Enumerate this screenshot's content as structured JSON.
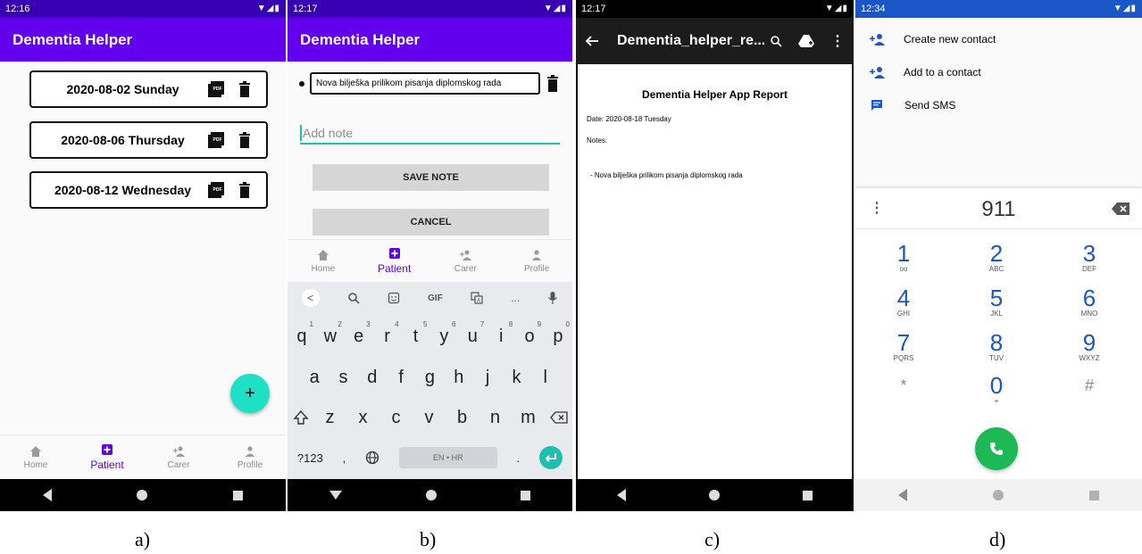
{
  "panel_a": {
    "status_time": "12:16",
    "app_title": "Dementia Helper",
    "notes": [
      {
        "date": "2020-08-02 Sunday"
      },
      {
        "date": "2020-08-06 Thursday"
      },
      {
        "date": "2020-08-12 Wednesday"
      }
    ],
    "fab_label": "+",
    "bottom_nav": [
      "Home",
      "Patient",
      "Carer",
      "Profile"
    ],
    "active_tab": "Patient"
  },
  "panel_b": {
    "status_time": "12:17",
    "app_title": "Dementia Helper",
    "note_item": "Nova bilješka prilikom pisanja diplomskog rada",
    "input_placeholder": "Add note",
    "save_label": "SAVE NOTE",
    "cancel_label": "CANCEL",
    "bottom_nav": [
      "Home",
      "Patient",
      "Carer",
      "Profile"
    ],
    "keyboard": {
      "toolbar": [
        "<",
        "search",
        "sticker",
        "GIF",
        "translate",
        "...",
        "mic"
      ],
      "row1": [
        {
          "k": "q",
          "n": "1"
        },
        {
          "k": "w",
          "n": "2"
        },
        {
          "k": "e",
          "n": "3"
        },
        {
          "k": "r",
          "n": "4"
        },
        {
          "k": "t",
          "n": "5"
        },
        {
          "k": "y",
          "n": "6"
        },
        {
          "k": "u",
          "n": "7"
        },
        {
          "k": "i",
          "n": "8"
        },
        {
          "k": "o",
          "n": "9"
        },
        {
          "k": "p",
          "n": "0"
        }
      ],
      "row2": [
        "a",
        "s",
        "d",
        "f",
        "g",
        "h",
        "j",
        "k",
        "l"
      ],
      "row3": [
        "z",
        "x",
        "c",
        "v",
        "b",
        "n",
        "m"
      ],
      "sym_label": "?123",
      "comma": ",",
      "space_label": "EN • HR",
      "period": "."
    }
  },
  "panel_c": {
    "status_time": "12:17",
    "title": "Dementia_helper_re...",
    "report_title": "Dementia Helper App Report",
    "date_line": "Date: 2020-08-18 Tuesday",
    "notes_label": "Notes:",
    "note_line": "- Nova bilješka prilikom pisanja diplomskog rada"
  },
  "panel_d": {
    "status_time": "12:34",
    "menu": [
      "Create new contact",
      "Add to a contact",
      "Send SMS"
    ],
    "number": "911",
    "keys": [
      {
        "d": "1",
        "l": "oo"
      },
      {
        "d": "2",
        "l": "ABC"
      },
      {
        "d": "3",
        "l": "DEF"
      },
      {
        "d": "4",
        "l": "GHI"
      },
      {
        "d": "5",
        "l": "JKL"
      },
      {
        "d": "6",
        "l": "MNO"
      },
      {
        "d": "7",
        "l": "PQRS"
      },
      {
        "d": "8",
        "l": "TUV"
      },
      {
        "d": "9",
        "l": "WXYZ"
      },
      {
        "d": "*",
        "l": ""
      },
      {
        "d": "0",
        "l": "+"
      },
      {
        "d": "#",
        "l": ""
      }
    ]
  },
  "captions": [
    "a)",
    "b)",
    "c)",
    "d)"
  ],
  "colors": {
    "primary": "#6200ee",
    "status": "#3700b3",
    "fab": "#1de0c4",
    "dialer_blue": "#1a56c8",
    "call_green": "#1db954"
  }
}
